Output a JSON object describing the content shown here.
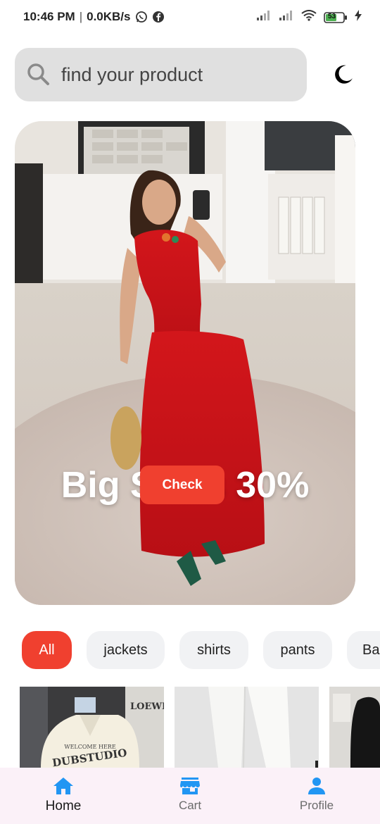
{
  "status_bar": {
    "time": "10:46 PM",
    "separator": "|",
    "data_speed": "0.0KB/s",
    "battery": "53"
  },
  "search": {
    "placeholder": "find your product"
  },
  "theme_toggle": {
    "icon": "moon-icon"
  },
  "banner": {
    "title": "Big Sales 30%",
    "button_label": "Check"
  },
  "categories": {
    "items": [
      "All",
      "jackets",
      "shirts",
      "pants",
      "Ba"
    ],
    "active_index": 0
  },
  "products": {
    "artwork_text": [
      "LOEWE",
      "DUBSTUDIO",
      "WELCOME HERE"
    ]
  },
  "bottom_nav": {
    "items": [
      {
        "label": "Home",
        "icon": "home-icon"
      },
      {
        "label": "Cart",
        "icon": "store-icon"
      },
      {
        "label": "Profile",
        "icon": "person-icon"
      }
    ],
    "active_index": 0
  },
  "colors": {
    "accent": "#f0402f",
    "nav_active": "#2196f3",
    "search_bg": "#e0e0e0",
    "chip_bg": "#f1f2f4",
    "nav_bg": "#fbf1f8"
  }
}
